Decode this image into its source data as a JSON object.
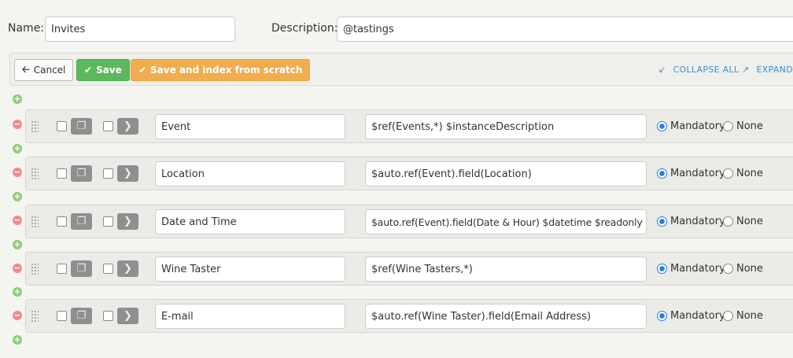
{
  "form": {
    "name_label": "Name:",
    "name_value": "Invites",
    "description_label": "Description:",
    "description_value": "@tastings"
  },
  "toolbar": {
    "cancel_label": "Cancel",
    "save_label": "Save",
    "save_index_label": "Save and index from scratch",
    "collapse_all_label": "COLLAPSE ALL",
    "expand_all_label": "EXPAND ALL"
  },
  "rows": [
    {
      "name": "Event",
      "expression": "$ref(Events,*) $instanceDescription",
      "option_mandatory": "Mandatory",
      "option_none": "None",
      "selected": "Mandatory"
    },
    {
      "name": "Location",
      "expression": "$auto.ref(Event).field(Location)",
      "option_mandatory": "Mandatory",
      "option_none": "None",
      "selected": "Mandatory"
    },
    {
      "name": "Date and Time",
      "expression": "$auto.ref(Event).field(Date & Hour) $datetime $readonly",
      "option_mandatory": "Mandatory",
      "option_none": "None",
      "selected": "Mandatory"
    },
    {
      "name": "Wine Taster",
      "expression": "$ref(Wine Tasters,*)",
      "option_mandatory": "Mandatory",
      "option_none": "None",
      "selected": "Mandatory"
    },
    {
      "name": "E-mail",
      "expression": "$auto.ref(Wine Taster).field(Email Address)",
      "option_mandatory": "Mandatory",
      "option_none": "None",
      "selected": "Mandatory"
    }
  ],
  "colors": {
    "save": "#5cb85c",
    "save_index": "#f0ad4e",
    "link": "#3c8fd0",
    "add_icon": "#8fca7a",
    "remove_icon": "#ea8a8a",
    "radio_selected": "#2a7be4"
  },
  "icons": {
    "cancel": "arrow-left-icon",
    "save": "check-icon",
    "save_index": "check-icon",
    "collapse": "collapse-arrows-icon",
    "expand": "expand-arrows-icon",
    "add": "plus-circle-icon",
    "remove": "minus-circle-icon",
    "drag": "drag-grip-icon",
    "copy": "copy-icon",
    "open": "chevron-right-icon"
  }
}
